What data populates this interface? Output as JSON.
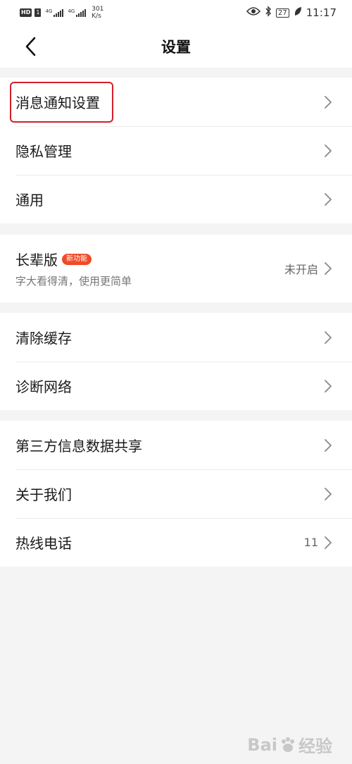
{
  "status_bar": {
    "hd": "HD",
    "sim": "1",
    "net1": "4G",
    "net2": "4G",
    "speed_value": "301",
    "speed_unit": "K/s",
    "battery": "27",
    "time": "11:17"
  },
  "header": {
    "title": "设置"
  },
  "groups": {
    "g1": [
      {
        "label": "消息通知设置"
      },
      {
        "label": "隐私管理"
      },
      {
        "label": "通用"
      }
    ],
    "elder": {
      "label": "长辈版",
      "badge": "新功能",
      "subtitle": "字大看得清，使用更简单",
      "value": "未开启"
    },
    "g3": [
      {
        "label": "清除缓存"
      },
      {
        "label": "诊断网络"
      }
    ],
    "g4": [
      {
        "label": "第三方信息数据共享"
      },
      {
        "label": "关于我们"
      },
      {
        "label": "热线电话",
        "value": "11"
      }
    ]
  },
  "watermark": {
    "brand_a": "Bai",
    "brand_b": "经验"
  },
  "colors": {
    "highlight": "#d21f2a",
    "badge": "#f04a26",
    "background": "#f4f4f4"
  }
}
